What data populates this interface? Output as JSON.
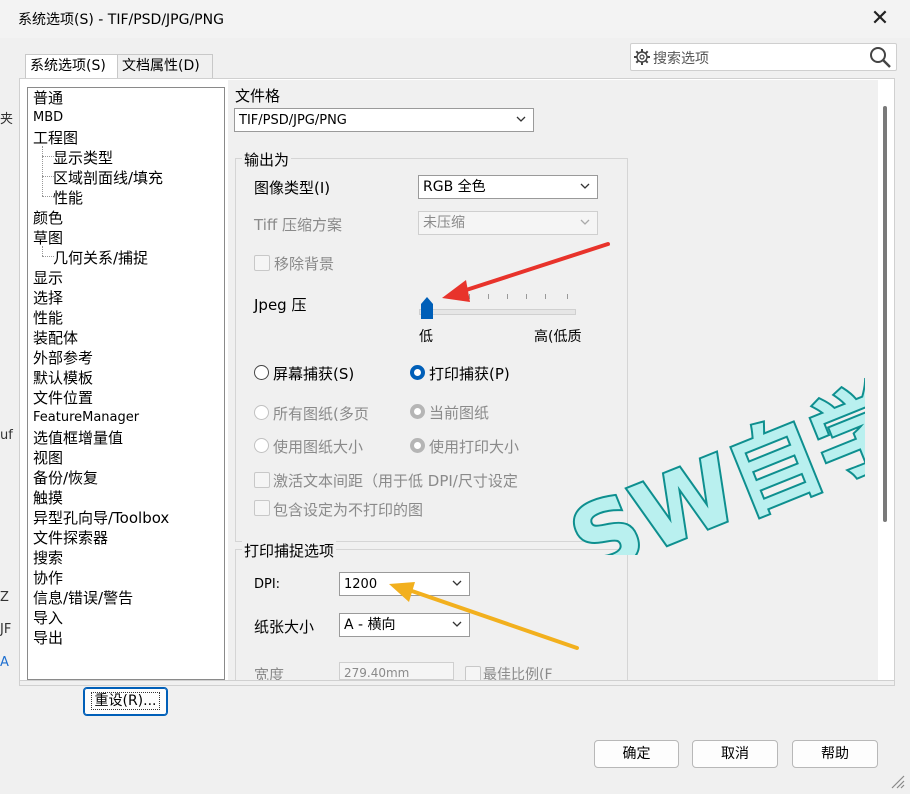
{
  "window": {
    "title": "系统选项(S) - TIF/PSD/JPG/PNG",
    "close_glyph": "✕"
  },
  "search": {
    "placeholder": "搜索选项",
    "icon": "search-icon",
    "gear": "gear-icon"
  },
  "tabs": [
    {
      "label": "系统选项(S)",
      "active": true
    },
    {
      "label": "文档属性(D)",
      "active": false
    }
  ],
  "tree": [
    {
      "label": "普通"
    },
    {
      "label": "MBD"
    },
    {
      "label": "工程图"
    },
    {
      "label": "显示类型"
    },
    {
      "label": "区域剖面线/填充"
    },
    {
      "label": "性能"
    },
    {
      "label": "颜色"
    },
    {
      "label": "草图"
    },
    {
      "label": "几何关系/捕捉"
    },
    {
      "label": "显示"
    },
    {
      "label": "选择"
    },
    {
      "label": "性能"
    },
    {
      "label": "装配体"
    },
    {
      "label": "外部参考"
    },
    {
      "label": "默认模板"
    },
    {
      "label": "文件位置"
    },
    {
      "label": "FeatureManager"
    },
    {
      "label": "选值框增量值"
    },
    {
      "label": "视图"
    },
    {
      "label": "备份/恢复"
    },
    {
      "label": "触摸"
    },
    {
      "label": "异型孔向导/Toolbox"
    },
    {
      "label": "文件探索器"
    },
    {
      "label": "搜索"
    },
    {
      "label": "协作"
    },
    {
      "label": "信息/错误/警告"
    },
    {
      "label": "导入"
    },
    {
      "label": "导出"
    }
  ],
  "panel": {
    "format_label": "文件格",
    "format_value": "TIF/PSD/JPG/PNG",
    "output_group": "输出为",
    "image_type_label": "图像类型(I)",
    "image_type_value": "RGB 全色",
    "tiff_label": "Tiff 压缩方案",
    "tiff_value": "未压缩",
    "remove_bg_label": "移除背景",
    "jpeg_label": "Jpeg 压",
    "slider_low": "低",
    "slider_high": "高(低质",
    "slider_position": 0,
    "screen_capture": "屏幕捕获(S)",
    "print_capture": "打印捕获(P)",
    "all_sheets": "所有图纸(多页",
    "current_sheet": "当前图纸",
    "use_sheet_size": "使用图纸大小",
    "use_print_size": "使用打印大小",
    "activate_text": "激活文本间距（用于低 DPI/尺寸设定",
    "include_nonprint": "包含设定为不打印的图",
    "print_group": "打印捕捉选项",
    "dpi_label": "DPI:",
    "dpi_value": "1200",
    "paper_label": "纸张大小",
    "paper_value": "A - 横向",
    "width_label": "宽度",
    "width_value": "279.40mm",
    "best_fit": "最佳比例(F"
  },
  "buttons": {
    "reset": "重设(R)...",
    "ok": "确定",
    "cancel": "取消",
    "help": "帮助"
  },
  "watermark": {
    "text": "SW自学"
  },
  "background": {
    "frag1": "夹",
    "frag2": "uf",
    "frag3": "Z",
    "frag4": "JF",
    "frag5": "A"
  },
  "colors": {
    "accent": "#005fb8",
    "watermark_fill": "#b9f0ef",
    "watermark_outline": "#0e8f8f",
    "red_arrow": "#e8332b",
    "yellow_arrow": "#f2b01e"
  }
}
